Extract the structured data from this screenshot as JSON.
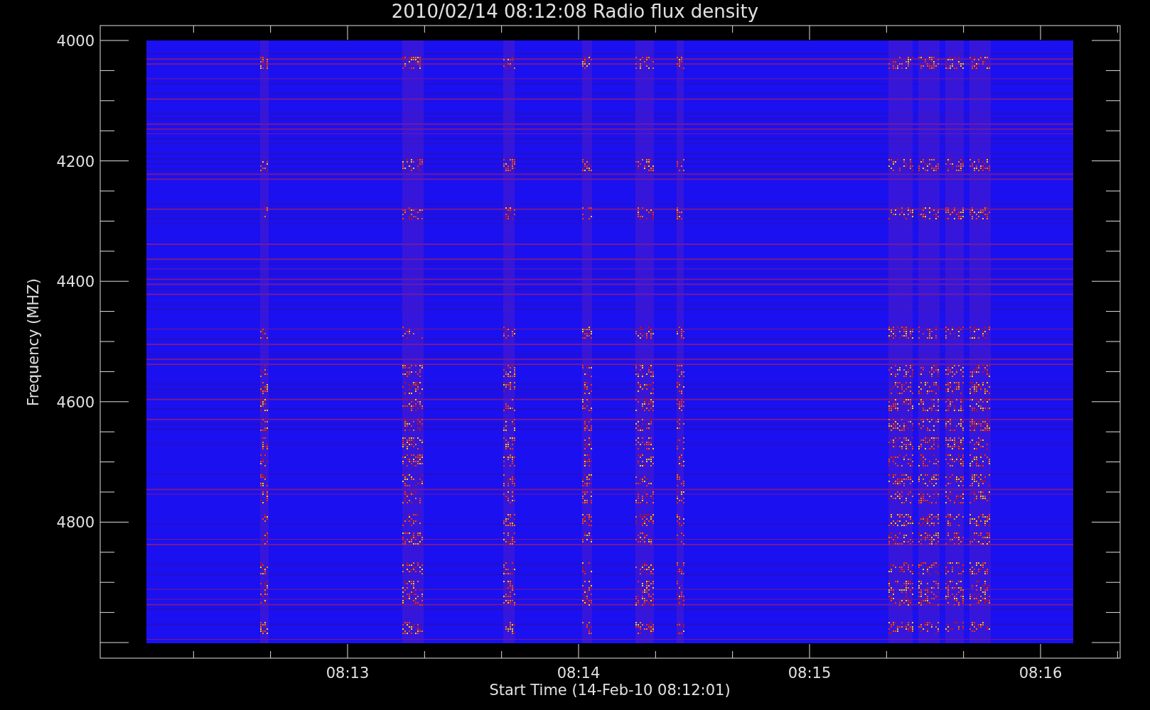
{
  "plot": {
    "title": "2010/02/14 08:12:08 Radio flux density",
    "ylabel": "Frequency (MHZ)",
    "xlabel": "Start Time (14-Feb-10 08:12:01)",
    "yticks": [
      "4000",
      "4200",
      "4400",
      "4600",
      "4800"
    ],
    "xticks": [
      "08:13",
      "08:14",
      "08:15",
      "08:16"
    ]
  }
}
